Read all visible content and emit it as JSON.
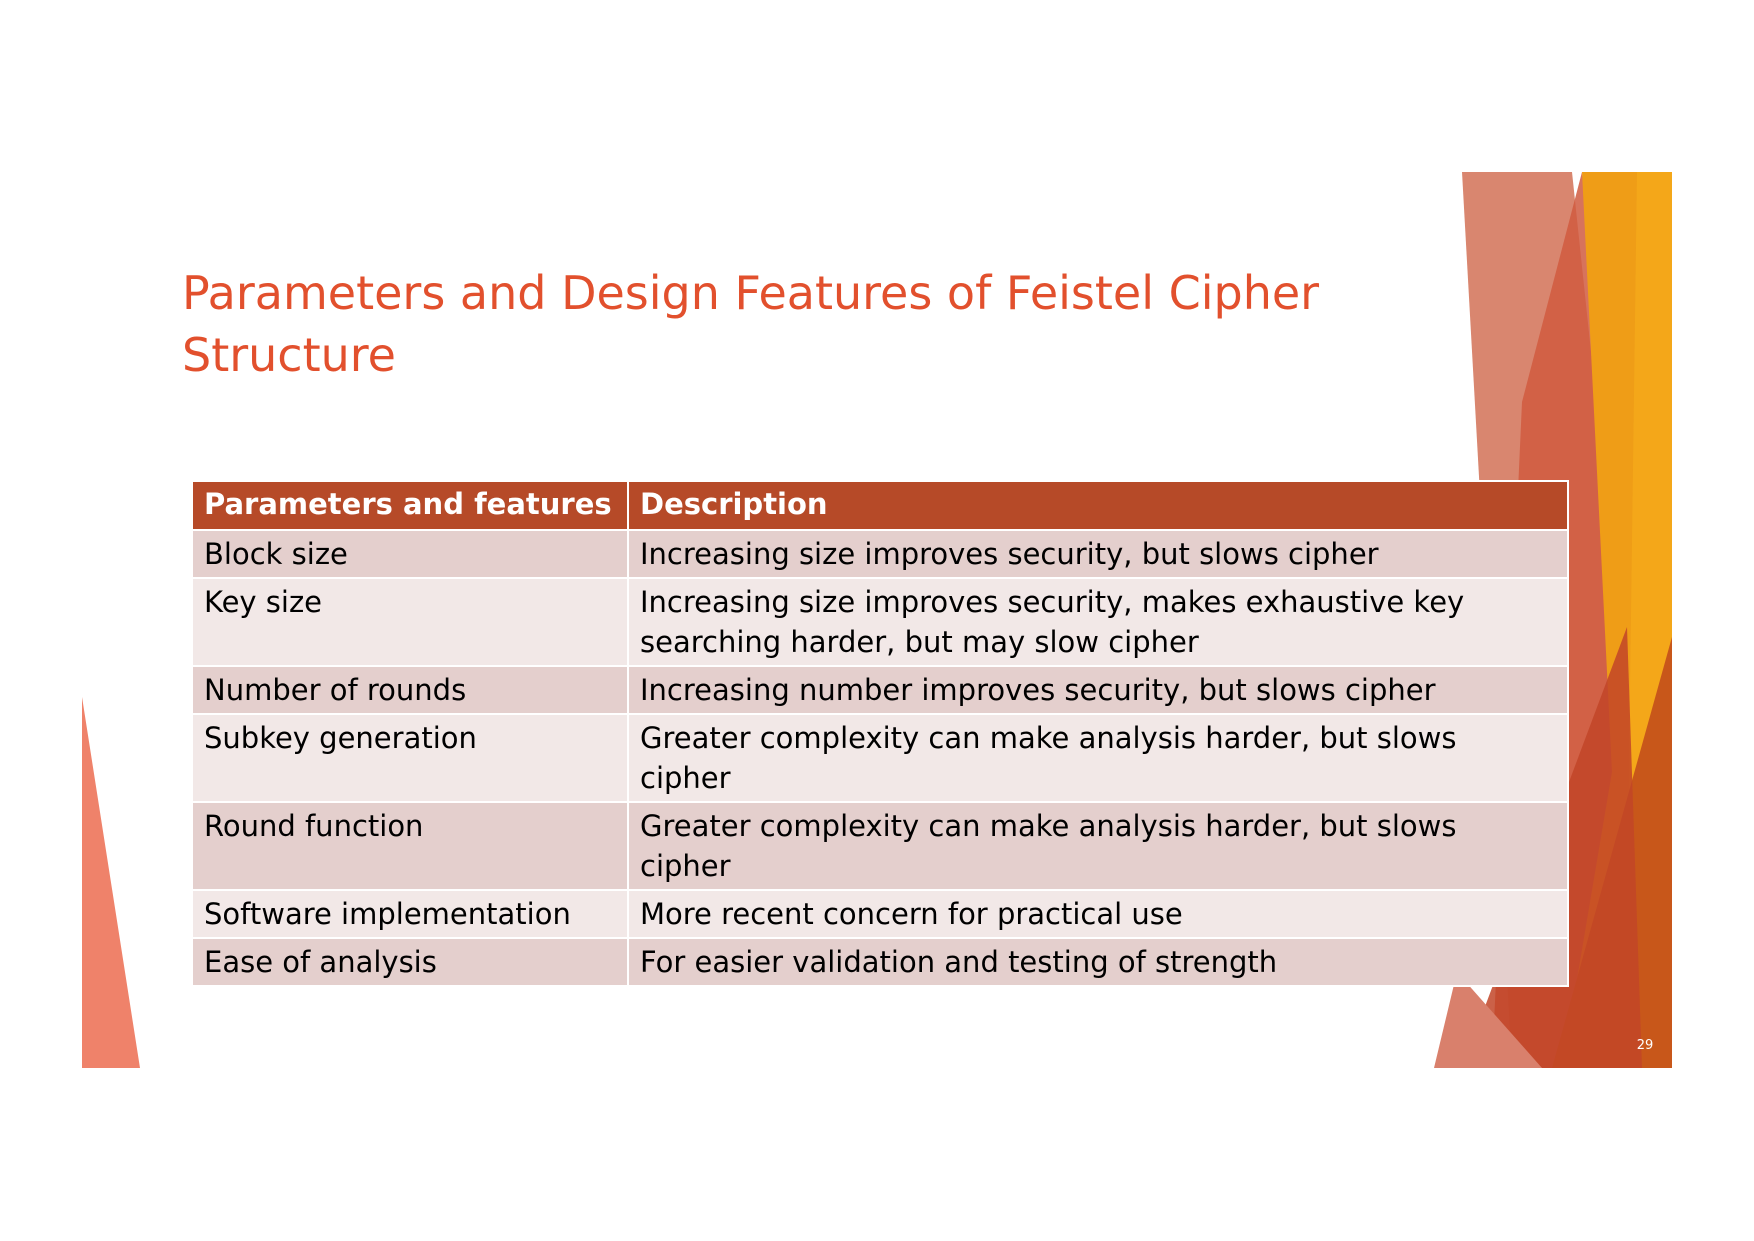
{
  "slide": {
    "title": "Parameters and Design Features of Feistel Cipher Structure",
    "page_number": "29"
  },
  "table": {
    "headers": [
      "Parameters and features",
      "Description"
    ],
    "rows": [
      {
        "parameter": "Block size",
        "description": "Increasing size improves security, but slows cipher"
      },
      {
        "parameter": "Key size",
        "description": "Increasing size improves security, makes exhaustive key searching harder, but may slow cipher"
      },
      {
        "parameter": "Number of rounds",
        "description": "Increasing number improves security, but slows cipher"
      },
      {
        "parameter": "Subkey generation",
        "description": "Greater complexity can make analysis harder, but slows cipher"
      },
      {
        "parameter": "Round function",
        "description": "Greater complexity can make analysis harder, but slows cipher"
      },
      {
        "parameter": "Software implementation",
        "description": "More recent concern for practical use"
      },
      {
        "parameter": "Ease of analysis",
        "description": "For easier validation and testing of strength"
      }
    ]
  },
  "colors": {
    "title": "#E2502D",
    "header_background": "#B64A28",
    "row_dark": "#E4CFCD",
    "row_light": "#F2E8E7",
    "accent_orange": "#EF9D17",
    "accent_red": "#D6533B",
    "accent_salmon": "#EF826A"
  }
}
